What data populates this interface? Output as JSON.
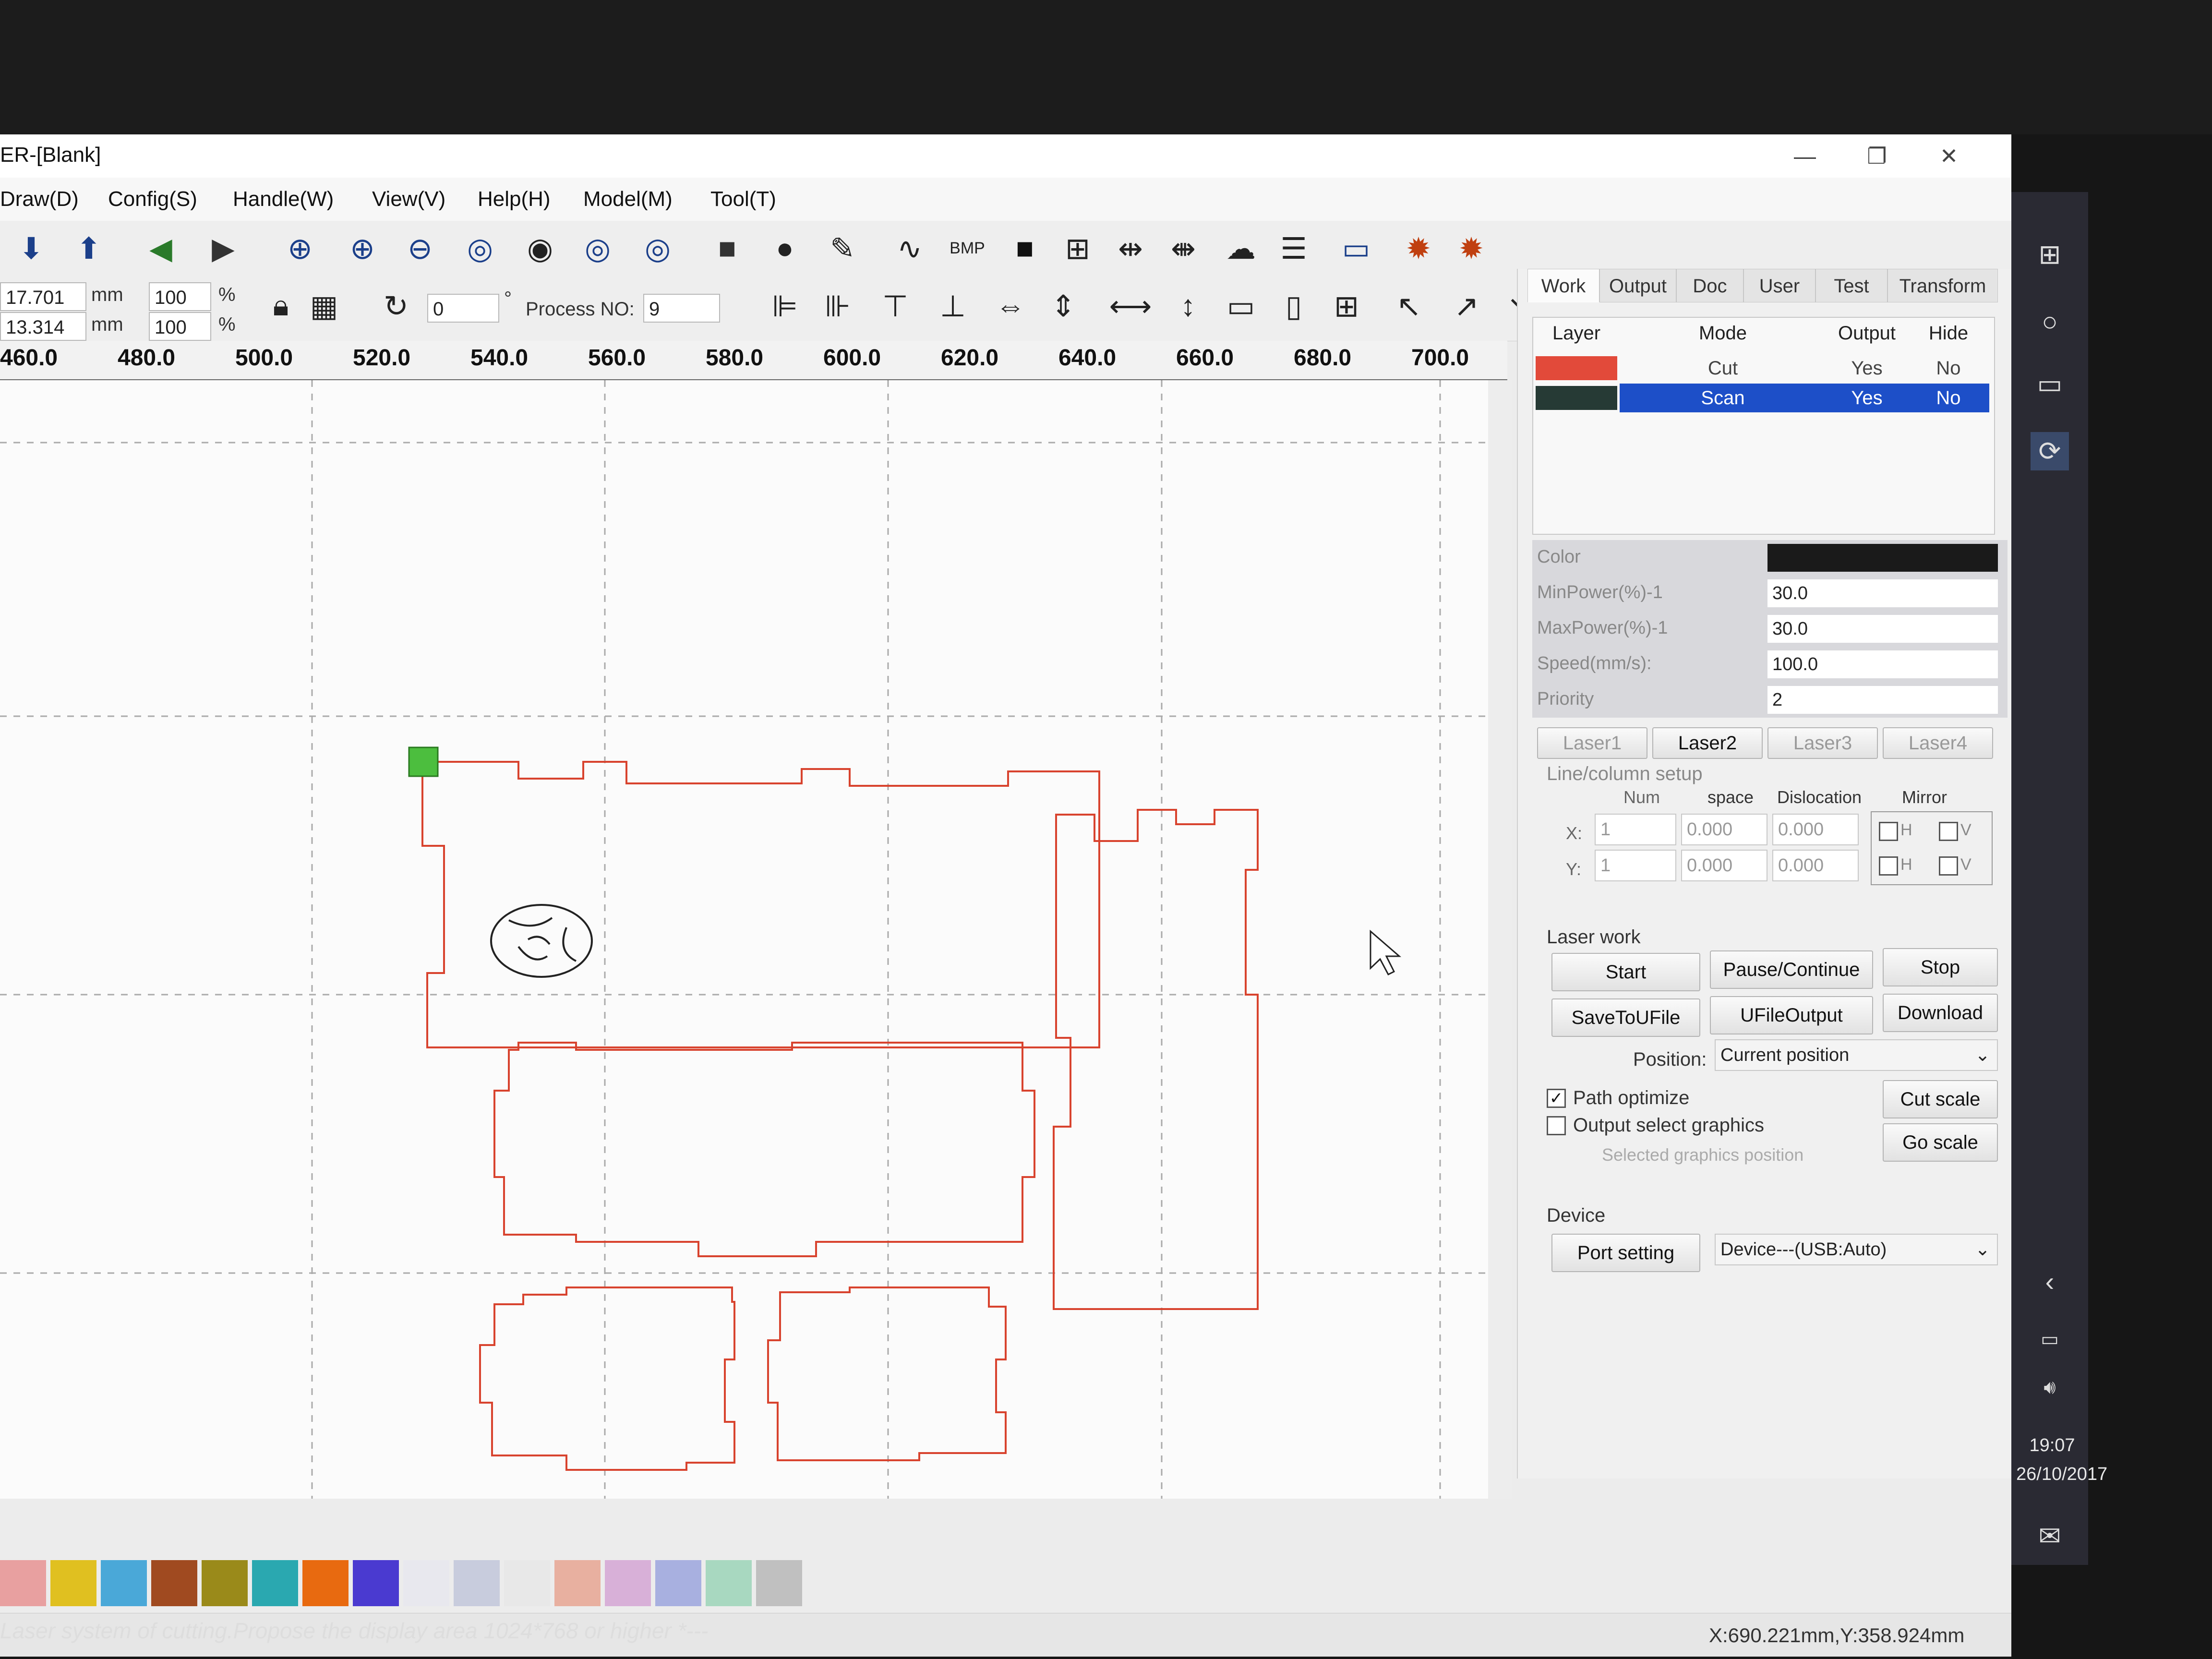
{
  "window": {
    "title": "ER-[Blank]",
    "controls": [
      "—",
      "❐",
      "✕"
    ]
  },
  "menu": [
    "Draw(D)",
    "Config(S)",
    "Handle(W)",
    "View(V)",
    "Help(H)",
    "Model(M)",
    "Tool(T)"
  ],
  "toolbar2": {
    "x_value": "17.701",
    "y_value": "13.314",
    "unit": "mm",
    "scale_x": "100",
    "scale_y": "100",
    "pct": "%",
    "rotate_value": "0",
    "degree": "°",
    "process_label": "Process NO:",
    "process_value": "9"
  },
  "ruler": [
    "460.0",
    "480.0",
    "500.0",
    "520.0",
    "540.0",
    "560.0",
    "580.0",
    "600.0",
    "620.0",
    "640.0",
    "660.0",
    "680.0",
    "700.0"
  ],
  "panel": {
    "tabs": [
      "Work",
      "Output",
      "Doc",
      "User",
      "Test",
      "Transform"
    ],
    "layer_headers": [
      "Layer",
      "Mode",
      "Output",
      "Hide"
    ],
    "layers": [
      {
        "color": "#e24a3a",
        "mode": "Cut",
        "output": "Yes",
        "hide": "No"
      },
      {
        "color": "#263a35",
        "mode": "Scan",
        "output": "Yes",
        "hide": "No"
      }
    ],
    "props": [
      {
        "label": "Color",
        "value": ""
      },
      {
        "label": "MinPower(%)-1",
        "value": "30.0"
      },
      {
        "label": "MaxPower(%)-1",
        "value": "30.0"
      },
      {
        "label": "Speed(mm/s):",
        "value": "100.0"
      },
      {
        "label": "Priority",
        "value": "2"
      }
    ],
    "laser_tabs": [
      "Laser1",
      "Laser2",
      "Laser3",
      "Laser4"
    ],
    "line_column": {
      "title": "Line/column setup",
      "headers": [
        "Num",
        "space",
        "Dislocation",
        "Mirror"
      ],
      "rows": [
        {
          "axis": "X:",
          "num": "1",
          "space": "0.000",
          "dislocation": "0.000",
          "h": "H",
          "v": "V"
        },
        {
          "axis": "Y:",
          "num": "1",
          "space": "0.000",
          "dislocation": "0.000",
          "h": "H",
          "v": "V"
        }
      ]
    },
    "laser_work": {
      "title": "Laser work",
      "start": "Start",
      "pause": "Pause/Continue",
      "stop": "Stop",
      "save": "SaveToUFile",
      "ufile": "UFileOutput",
      "download": "Download",
      "position_label": "Position:",
      "position_value": "Current position",
      "path_optimize": "Path optimize",
      "output_select": "Output select graphics",
      "selected_pos": "Selected graphics position",
      "cut_scale": "Cut scale",
      "go_scale": "Go scale"
    },
    "device": {
      "title": "Device",
      "port": "Port setting",
      "value": "Device---(USB:Auto)"
    }
  },
  "palette": [
    "#e8a0a0",
    "#e0c020",
    "#4aa8d8",
    "#a04a20",
    "#9a8a1a",
    "#2aa8b0",
    "#e86a10",
    "#4a3ad0",
    "#e8e8ee",
    "#c8ccdd",
    "#e8e8e8",
    "#e8b0a0",
    "#d8b0d8",
    "#a8b0e0",
    "#a8d8c0",
    "#c0c0c0"
  ],
  "status": {
    "coords": "X:690.221mm,Y:358.924mm"
  },
  "taskbar": {
    "time": "19:07",
    "date": "26/10/2017"
  },
  "bottom_message": "Laser system of cutting.Propose the display area 1024*768 or higher *---"
}
